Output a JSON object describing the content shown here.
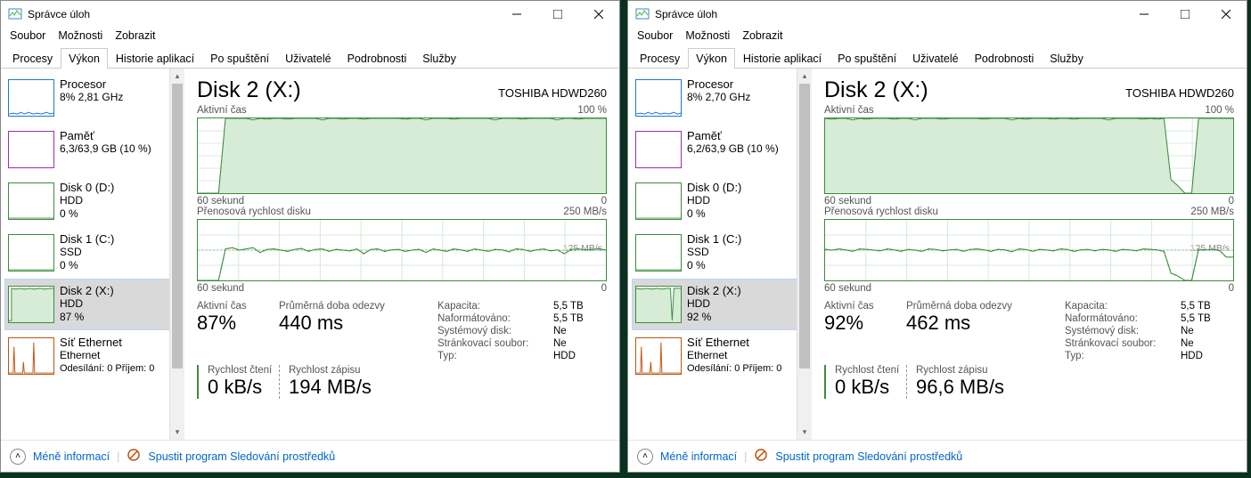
{
  "title": "Správce úloh",
  "menu": [
    "Soubor",
    "Možnosti",
    "Zobrazit"
  ],
  "tabs": [
    "Procesy",
    "Výkon",
    "Historie aplikací",
    "Po spuštění",
    "Uživatelé",
    "Podrobnosti",
    "Služby"
  ],
  "active_tab": 1,
  "footer": {
    "less": "Méně informací",
    "resmon": "Spustit program Sledování prostředků"
  },
  "windows": [
    {
      "sidebar": [
        {
          "title": "Procesor",
          "line2": "8% 2,81 GHz",
          "line3": "",
          "type": "cpu",
          "selected": false,
          "color": "#1f77d4"
        },
        {
          "title": "Paměť",
          "line2": "6,3/63,9 GB (10 %)",
          "line3": "",
          "type": "mem",
          "selected": false,
          "color": "#9b2fae"
        },
        {
          "title": "Disk 0 (D:)",
          "line2": "HDD",
          "line3": "0 %",
          "type": "disk",
          "selected": false,
          "color": "#3c8c3c"
        },
        {
          "title": "Disk 1 (C:)",
          "line2": "SSD",
          "line3": "0 %",
          "type": "disk",
          "selected": false,
          "color": "#3c8c3c"
        },
        {
          "title": "Disk 2 (X:)",
          "line2": "HDD",
          "line3": "87 %",
          "type": "disk2",
          "selected": true,
          "color": "#3c8c3c"
        },
        {
          "title": "Síť Ethernet",
          "line2": "Ethernet",
          "line3": "Odesílání: 0 Příjem: 0",
          "type": "net",
          "selected": false,
          "color": "#c0530e"
        }
      ],
      "disk": {
        "title": "Disk 2 (X:)",
        "model": "TOSHIBA HDWD260",
        "chart1label": "Aktivní čas",
        "chart1max": "100 %",
        "axis60": "60 sekund",
        "axis0": "0",
        "chart2label": "Přenosová rychlost disku",
        "chart2max": "250 MB/s",
        "chart2ref": "125 MB/s",
        "stat_active_label": "Aktivní čas",
        "stat_active_val": "87%",
        "stat_resp_label": "Průměrná doba odezvy",
        "stat_resp_val": "440 ms",
        "stat_read_label": "Rychlost čtení",
        "stat_read_val": "0 kB/s",
        "stat_write_label": "Rychlost zápisu",
        "stat_write_val": "194 MB/s",
        "details": {
          "Kapacita:": "5,5 TB",
          "Naformátováno:": "5,5 TB",
          "Systémový disk:": "Ne",
          "Stránkovací soubor:": "Ne",
          "Typ:": "HDD"
        }
      }
    },
    {
      "sidebar": [
        {
          "title": "Procesor",
          "line2": "8% 2,70 GHz",
          "line3": "",
          "type": "cpu",
          "selected": false,
          "color": "#1f77d4"
        },
        {
          "title": "Paměť",
          "line2": "6,2/63,9 GB (10 %)",
          "line3": "",
          "type": "mem",
          "selected": false,
          "color": "#9b2fae"
        },
        {
          "title": "Disk 0 (D:)",
          "line2": "HDD",
          "line3": "0 %",
          "type": "disk",
          "selected": false,
          "color": "#3c8c3c"
        },
        {
          "title": "Disk 1 (C:)",
          "line2": "SSD",
          "line3": "0 %",
          "type": "disk",
          "selected": false,
          "color": "#3c8c3c"
        },
        {
          "title": "Disk 2 (X:)",
          "line2": "HDD",
          "line3": "92 %",
          "type": "disk2b",
          "selected": true,
          "color": "#3c8c3c"
        },
        {
          "title": "Síť Ethernet",
          "line2": "Ethernet",
          "line3": "Odesílání: 0 Příjem: 0",
          "type": "net",
          "selected": false,
          "color": "#c0530e"
        }
      ],
      "disk": {
        "title": "Disk 2 (X:)",
        "model": "TOSHIBA HDWD260",
        "chart1label": "Aktivní čas",
        "chart1max": "100 %",
        "axis60": "60 sekund",
        "axis0": "0",
        "chart2label": "Přenosová rychlost disku",
        "chart2max": "250 MB/s",
        "chart2ref": "125 MB/s",
        "stat_active_label": "Aktivní čas",
        "stat_active_val": "92%",
        "stat_resp_label": "Průměrná doba odezvy",
        "stat_resp_val": "462 ms",
        "stat_read_label": "Rychlost čtení",
        "stat_read_val": "0 kB/s",
        "stat_write_label": "Rychlost zápisu",
        "stat_write_val": "96,6 MB/s",
        "details": {
          "Kapacita:": "5,5 TB",
          "Naformátováno:": "5,5 TB",
          "Systémový disk:": "Ne",
          "Stránkovací soubor:": "Ne",
          "Typ:": "HDD"
        }
      }
    }
  ],
  "chart_data": [
    {
      "type": "line",
      "title": "Aktivní čas (W1)",
      "ylim": [
        0,
        100
      ],
      "x_seconds": [
        60,
        0
      ],
      "values": [
        0,
        0,
        0,
        0,
        100,
        100,
        100,
        100,
        98,
        100,
        99,
        100,
        100,
        99,
        100,
        100,
        100,
        100,
        98,
        100,
        100,
        99,
        100,
        100,
        99,
        100,
        100,
        100,
        100,
        100,
        99,
        100,
        100,
        98,
        100,
        100,
        100,
        99,
        100,
        100,
        100,
        100,
        100,
        98,
        100,
        100,
        100,
        99,
        100,
        100,
        100,
        100,
        98,
        100,
        100,
        99,
        100,
        100,
        100,
        100
      ]
    },
    {
      "type": "line",
      "title": "Přenosová rychlost disku (W1)",
      "ylabel": "MB/s",
      "ylim": [
        0,
        250
      ],
      "x_seconds": [
        60,
        0
      ],
      "values_write": [
        0,
        0,
        0,
        0,
        130,
        135,
        125,
        130,
        135,
        115,
        128,
        130,
        125,
        120,
        128,
        132,
        120,
        128,
        130,
        120,
        128,
        125,
        122,
        130,
        110,
        128,
        130,
        120,
        126,
        128,
        120,
        125,
        128,
        115,
        130,
        125,
        120,
        130,
        126,
        120,
        130,
        125,
        120,
        128,
        126,
        118,
        130,
        128,
        120,
        126,
        130,
        122,
        126,
        110,
        128,
        130,
        126,
        128,
        130,
        126
      ],
      "values_read": [
        0,
        0,
        0,
        0,
        0,
        0,
        0,
        0,
        0,
        0,
        0,
        0,
        0,
        0,
        0,
        0,
        0,
        0,
        0,
        0,
        0,
        0,
        0,
        0,
        0,
        0,
        0,
        0,
        0,
        0,
        0,
        0,
        0,
        0,
        0,
        0,
        0,
        0,
        0,
        0,
        0,
        0,
        0,
        0,
        0,
        0,
        0,
        0,
        0,
        0,
        0,
        0,
        0,
        0,
        0,
        0,
        0,
        0,
        0,
        0
      ]
    },
    {
      "type": "line",
      "title": "Aktivní čas (W2)",
      "ylim": [
        0,
        100
      ],
      "x_seconds": [
        60,
        0
      ],
      "values": [
        100,
        99,
        100,
        100,
        98,
        100,
        99,
        100,
        100,
        100,
        99,
        100,
        100,
        98,
        100,
        100,
        100,
        99,
        100,
        100,
        100,
        100,
        100,
        99,
        100,
        100,
        100,
        98,
        100,
        99,
        100,
        100,
        100,
        99,
        100,
        100,
        99,
        100,
        100,
        100,
        100,
        98,
        100,
        100,
        100,
        100,
        99,
        100,
        99,
        100,
        18,
        10,
        0,
        0,
        100,
        100,
        100,
        100,
        100,
        100
      ]
    },
    {
      "type": "line",
      "title": "Přenosová rychlost disku (W2)",
      "ylabel": "MB/s",
      "ylim": [
        0,
        250
      ],
      "x_seconds": [
        60,
        0
      ],
      "values_write": [
        128,
        125,
        130,
        126,
        120,
        130,
        128,
        125,
        122,
        130,
        126,
        120,
        128,
        125,
        120,
        130,
        128,
        122,
        126,
        128,
        120,
        128,
        130,
        126,
        120,
        128,
        126,
        118,
        130,
        128,
        120,
        128,
        126,
        122,
        130,
        128,
        120,
        126,
        128,
        122,
        128,
        126,
        120,
        128,
        126,
        122,
        130,
        128,
        126,
        120,
        30,
        18,
        0,
        0,
        128,
        126,
        128,
        124,
        96,
        96
      ],
      "values_read": [
        0,
        0,
        0,
        0,
        0,
        0,
        0,
        0,
        0,
        0,
        0,
        0,
        0,
        0,
        0,
        0,
        0,
        0,
        0,
        0,
        0,
        0,
        0,
        0,
        0,
        0,
        0,
        0,
        0,
        0,
        0,
        0,
        0,
        0,
        0,
        0,
        0,
        0,
        0,
        0,
        0,
        0,
        0,
        0,
        0,
        0,
        0,
        0,
        0,
        0,
        0,
        0,
        0,
        0,
        0,
        0,
        0,
        0,
        0,
        0
      ]
    }
  ]
}
